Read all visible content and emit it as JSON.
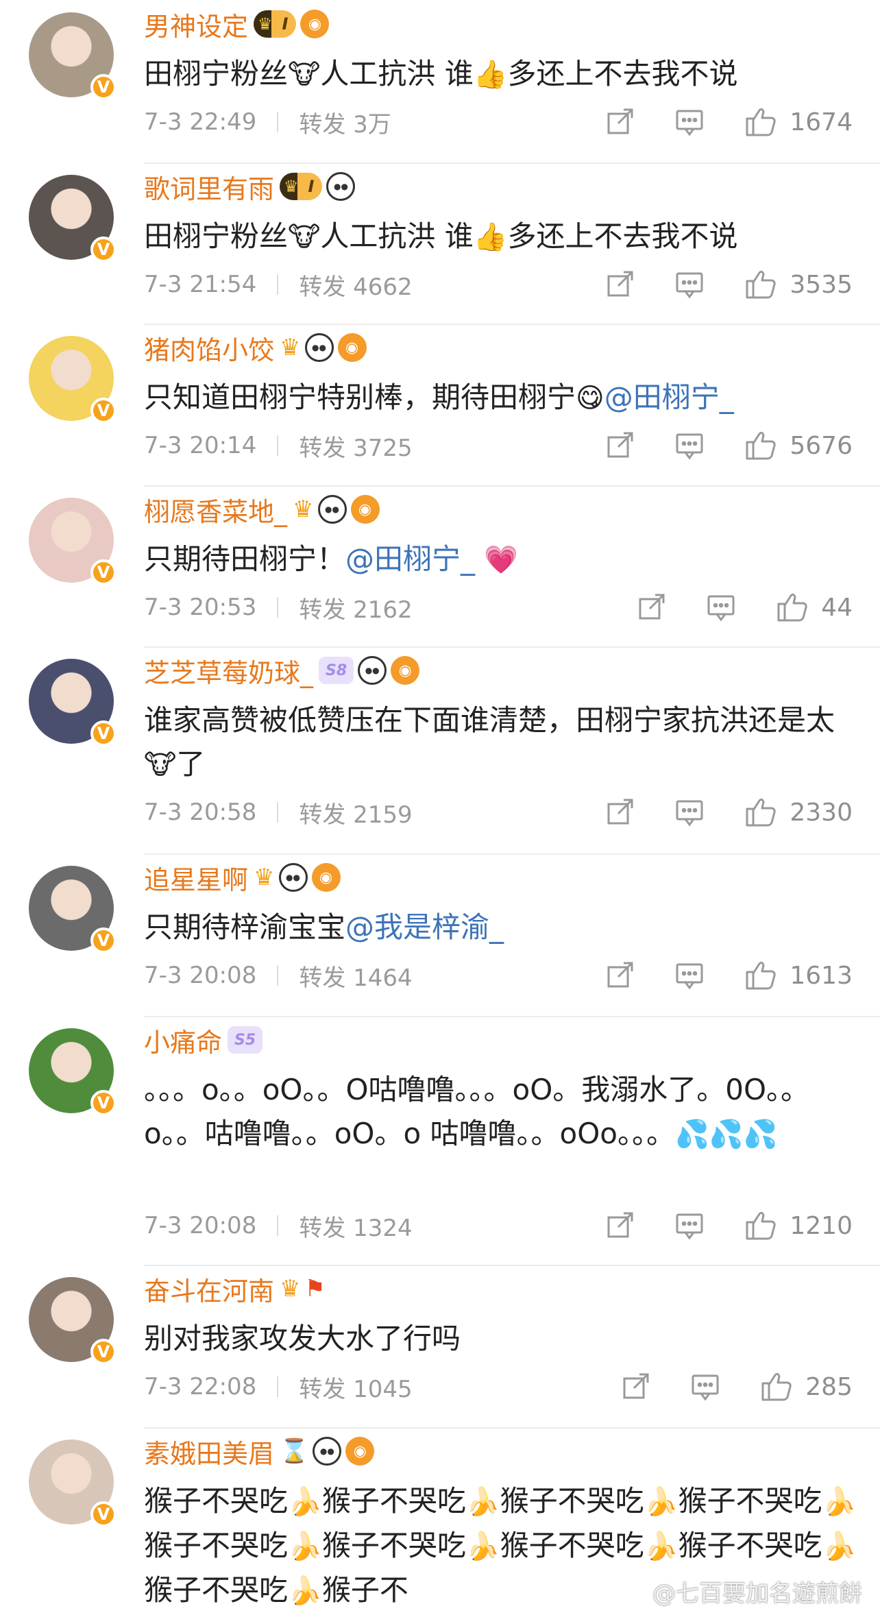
{
  "comments": [
    {
      "username": "男神设定",
      "badges": [
        "vip-1",
        "fish"
      ],
      "text": [
        {
          "t": "田栩宁粉丝"
        },
        {
          "e": "🐮"
        },
        {
          "t": "人工抗洪 谁"
        },
        {
          "e": "👍"
        },
        {
          "t": "多还上不去我不说"
        }
      ],
      "time": "7-3 22:49",
      "repost_label": "转发 3万",
      "likes": "1674",
      "avatar_color": "#a99a88"
    },
    {
      "username": "歌词里有雨",
      "badges": [
        "vip-1",
        "panda"
      ],
      "text": [
        {
          "t": "田栩宁粉丝"
        },
        {
          "e": "🐮"
        },
        {
          "t": "人工抗洪 谁"
        },
        {
          "e": "👍"
        },
        {
          "t": "多还上不去我不说"
        }
      ],
      "time": "7-3 21:54",
      "repost_label": "转发 4662",
      "likes": "3535",
      "avatar_color": "#5c5450"
    },
    {
      "username": "猪肉馅小饺",
      "badges": [
        "crown",
        "panda",
        "fish"
      ],
      "text": [
        {
          "t": "只知道田栩宁特别棒，期待田栩宁"
        },
        {
          "e": "😋"
        },
        {
          "m": "@田栩宁_"
        }
      ],
      "time": "7-3 20:14",
      "repost_label": "转发 3725",
      "likes": "5676",
      "avatar_color": "#f4d35e"
    },
    {
      "username": "栩愿香菜地_",
      "badges": [
        "crown",
        "panda",
        "fish"
      ],
      "text": [
        {
          "t": "只期待田栩宁！"
        },
        {
          "m": "@田栩宁_"
        },
        {
          "t": " "
        },
        {
          "e": "💗"
        }
      ],
      "time": "7-3 20:53",
      "repost_label": "转发 2162",
      "likes": "44",
      "avatar_color": "#e8c9c4"
    },
    {
      "username": "芝芝草莓奶球_",
      "badges": [
        "s8",
        "panda",
        "fish"
      ],
      "text": [
        {
          "t": "谁家高赞被低赞压在下面谁清楚，田栩宁家抗洪还是太"
        },
        {
          "e": "🐮"
        },
        {
          "t": "了"
        }
      ],
      "time": "7-3 20:58",
      "repost_label": "转发 2159",
      "likes": "2330",
      "avatar_color": "#4a4f6d"
    },
    {
      "username": "追星星啊",
      "badges": [
        "crown",
        "panda",
        "fish"
      ],
      "text": [
        {
          "t": "只期待梓渝宝宝"
        },
        {
          "m": "@我是梓渝_"
        }
      ],
      "time": "7-3 20:08",
      "repost_label": "转发 1464",
      "likes": "1613",
      "avatar_color": "#6b6b6b"
    },
    {
      "username": "小痛命",
      "badges": [
        "s5"
      ],
      "text": [
        {
          "t": "。。。o。。oO。。O咕噜噜。。。oO。我溺水了。0O。。o。。咕噜噜。。oO。o 咕噜噜。。oOo。。。"
        },
        {
          "e": "💦💦💦"
        }
      ],
      "time": "7-3 20:08",
      "repost_label": "转发 1324",
      "likes": "1210",
      "avatar_color": "#4f8c3c"
    },
    {
      "username": "奋斗在河南",
      "badges": [
        "crown",
        "flag"
      ],
      "text": [
        {
          "t": "别对我家攻发大水了行吗"
        }
      ],
      "time": "7-3 22:08",
      "repost_label": "转发 1045",
      "likes": "285",
      "avatar_color": "#8a7b6e"
    },
    {
      "username": "素娥田美眉",
      "badges": [
        "hourglass",
        "panda",
        "fish"
      ],
      "text": [
        {
          "t": "猴子不哭吃"
        },
        {
          "e": "🍌"
        },
        {
          "t": "猴子不哭吃"
        },
        {
          "e": "🍌"
        },
        {
          "t": "猴子不哭吃"
        },
        {
          "e": "🍌"
        },
        {
          "t": "猴子不哭吃"
        },
        {
          "e": "🍌"
        },
        {
          "t": "猴子不哭吃"
        },
        {
          "e": "🍌"
        },
        {
          "t": "猴子不哭吃"
        },
        {
          "e": "🍌"
        },
        {
          "t": "猴子不哭吃"
        },
        {
          "e": "🍌"
        },
        {
          "t": "猴子不哭吃"
        },
        {
          "e": "🍌"
        },
        {
          "t": "猴子不哭吃"
        },
        {
          "e": "🍌"
        },
        {
          "t": "猴子不"
        }
      ],
      "time": "",
      "repost_label": "",
      "likes": "",
      "avatar_color": "#d8c7b8"
    }
  ],
  "watermark": "@七百要加名遊煎餅",
  "colors": {
    "username": "#e7781c",
    "mention": "#3d73b8",
    "meta": "#9a9a9a",
    "vbadge_orange": "#f7a21b"
  },
  "icons": {
    "share": "share-icon",
    "comment": "comment-icon",
    "like": "like-icon"
  }
}
